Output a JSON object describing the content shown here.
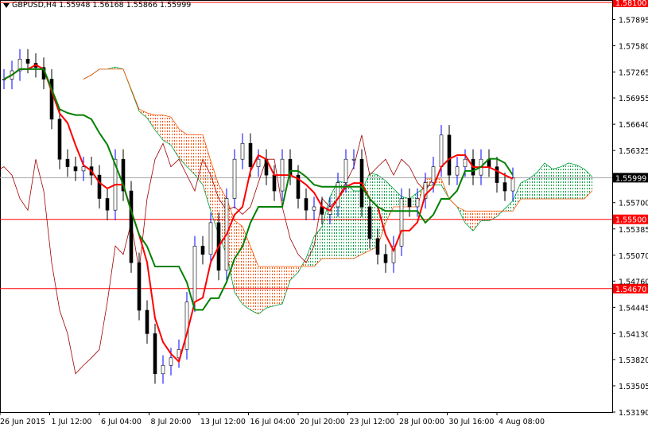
{
  "header": {
    "symbol": "GBPUSD,H4",
    "open": "1.55948",
    "high": "1.56168",
    "low": "1.55866",
    "close": "1.55999"
  },
  "chart_data": {
    "type": "candlestick",
    "title": "GBPUSD,H4",
    "ylim": [
      1.5316,
      1.581
    ],
    "y_ticks": [
      "1.57895",
      "1.57580",
      "1.57265",
      "1.56955",
      "1.56640",
      "1.56325",
      "1.55700",
      "1.55385",
      "1.55070",
      "1.54760",
      "1.54445",
      "1.54130",
      "1.53820",
      "1.53505",
      "1.53190"
    ],
    "x_ticks": [
      "26 Jun 2015",
      "1 Jul 12:00",
      "6 Jul 04:00",
      "8 Jul 20:00",
      "13 Jul 12:00",
      "16 Jul 04:00",
      "20 Jul 20:00",
      "23 Jul 12:00",
      "28 Jul 00:00",
      "30 Jul 16:00",
      "4 Aug 08:00"
    ],
    "levels": [
      {
        "price": 1.581,
        "label": "1.58100",
        "color": "#ff0000"
      },
      {
        "price": 1.55999,
        "label": "1.55999",
        "color": "#000000",
        "line": "#a0a0a0"
      },
      {
        "price": 1.555,
        "label": "1.55500",
        "color": "#ff0000"
      },
      {
        "price": 1.5467,
        "label": "1.54670",
        "color": "#ff0000"
      }
    ],
    "closes": [
      1.5718,
      1.5728,
      1.5742,
      1.5737,
      1.5732,
      1.5718,
      1.567,
      1.5622,
      1.5613,
      1.5608,
      1.5613,
      1.5603,
      1.5575,
      1.5561,
      1.5622,
      1.5584,
      1.5498,
      1.5441,
      1.5413,
      1.5365,
      1.5375,
      1.5384,
      1.5394,
      1.5451,
      1.5518,
      1.5508,
      1.5546,
      1.5489,
      1.5575,
      1.5622,
      1.5641,
      1.5613,
      1.5622,
      1.5603,
      1.5584,
      1.5622,
      1.5603,
      1.5575,
      1.5561,
      1.5565,
      1.5556,
      1.5565,
      1.5594,
      1.5622,
      1.5622,
      1.5565,
      1.5527,
      1.5508,
      1.5498,
      1.5518,
      1.5575,
      1.5565,
      1.5575,
      1.5594,
      1.5613,
      1.5651,
      1.5603,
      1.5613,
      1.5622,
      1.5603,
      1.5622,
      1.5613,
      1.5594,
      1.5584,
      1.56
    ],
    "indicators": {
      "tenkan_color": "#ff0000",
      "kijun_color": "#008000",
      "chikou_color": "#a00000",
      "cloud_up": "#00a040",
      "cloud_down": "#ff5000"
    }
  }
}
